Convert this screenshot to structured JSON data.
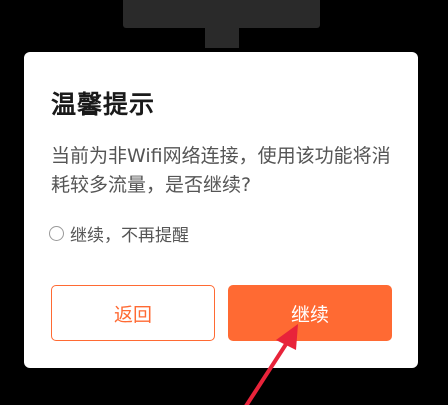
{
  "dialog": {
    "title": "温馨提示",
    "message": "当前为非Wifi网络连接，使用该功能将消耗较多流量，是否继续?",
    "checkbox_label": "继续，不再提醒",
    "checkbox_checked": false,
    "back_label": "返回",
    "continue_label": "继续"
  },
  "colors": {
    "accent": "#ff6a33",
    "annotation_arrow": "#e8233a",
    "overlay": "#000000",
    "dialog_bg": "#ffffff"
  },
  "icons": {
    "annotation": "red-arrow-icon",
    "checkbox": "radio-circle-icon"
  }
}
